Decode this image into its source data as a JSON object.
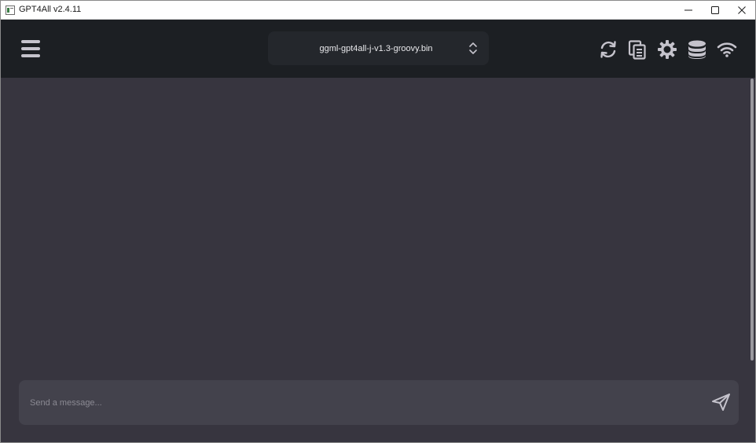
{
  "window": {
    "title": "GPT4All v2.4.11",
    "controls": {
      "minimize_icon": "minimize-icon",
      "maximize_icon": "maximize-icon",
      "close_icon": "close-icon"
    }
  },
  "toolbar": {
    "menu_icon": "hamburger-menu-icon",
    "model_selector": {
      "value": "ggml-gpt4all-j-v1.3-groovy.bin",
      "icon": "chevron-up-down-icon"
    },
    "actions": [
      {
        "name": "reset-chat-button",
        "icon": "refresh-icon"
      },
      {
        "name": "copy-conversation-button",
        "icon": "copy-icon"
      },
      {
        "name": "settings-button",
        "icon": "gear-icon"
      },
      {
        "name": "localdocs-button",
        "icon": "database-icon"
      },
      {
        "name": "network-button",
        "icon": "wifi-icon"
      }
    ]
  },
  "chat": {
    "input": {
      "value": "",
      "placeholder": "Send a message..."
    },
    "send_icon": "send-icon"
  },
  "colors": {
    "toolbar_bg": "#1c1f23",
    "chat_bg": "#37353f",
    "input_bg": "#43424c",
    "icon": "#c5c3cc"
  }
}
